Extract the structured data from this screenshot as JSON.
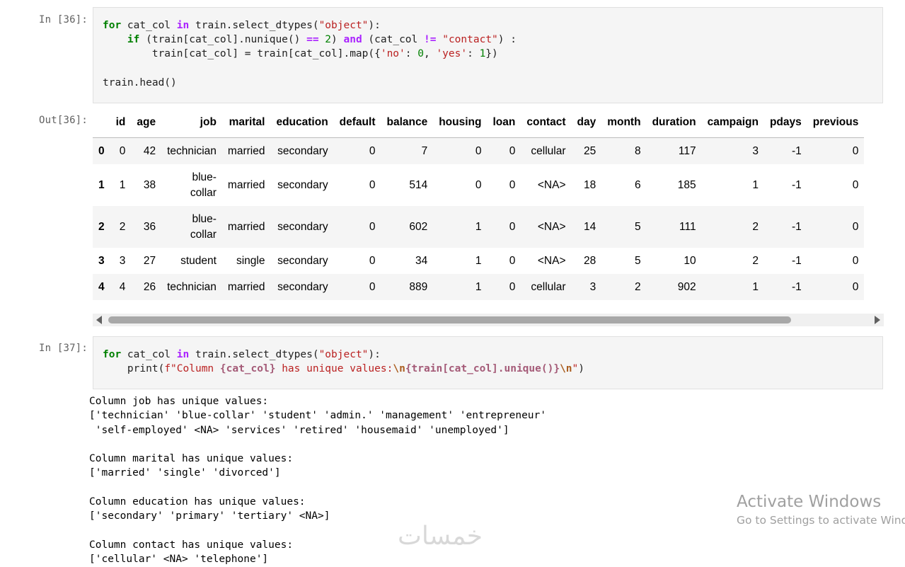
{
  "cell36": {
    "in_prompt": "In [36]:",
    "out_prompt": "Out[36]:",
    "code_line1_kw": "for",
    "code_line1_a": " cat_col ",
    "code_line1_in": "in",
    "code_line1_b": " train.select_dtypes(",
    "code_line1_str": "\"object\"",
    "code_line1_c": "):",
    "code_line2_indent": "    ",
    "code_line2_if": "if",
    "code_line2_a": " (train[cat_col].nunique() ",
    "code_line2_eq": "==",
    "code_line2_sp": " ",
    "code_line2_num": "2",
    "code_line2_b": ") ",
    "code_line2_and": "and",
    "code_line2_c": " (cat_col ",
    "code_line2_ne": "!=",
    "code_line2_sp2": " ",
    "code_line2_str": "\"contact\"",
    "code_line2_d": ") :",
    "code_line3_a": "        train[cat_col] = train[cat_col].map({",
    "code_line3_s1": "'no'",
    "code_line3_b": ": ",
    "code_line3_n1": "0",
    "code_line3_c": ", ",
    "code_line3_s2": "'yes'",
    "code_line3_d": ": ",
    "code_line3_n2": "1",
    "code_line3_e": "})",
    "code_line5": "train.head()"
  },
  "dataframe": {
    "columns": [
      "",
      "id",
      "age",
      "job",
      "marital",
      "education",
      "default",
      "balance",
      "housing",
      "loan",
      "contact",
      "day",
      "month",
      "duration",
      "campaign",
      "pdays",
      "previous"
    ],
    "rows": [
      {
        "index": "0",
        "cells": [
          "0",
          "42",
          "technician",
          "married",
          "secondary",
          "0",
          "7",
          "0",
          "0",
          "cellular",
          "25",
          "8",
          "117",
          "3",
          "-1",
          "0"
        ]
      },
      {
        "index": "1",
        "cells": [
          "1",
          "38",
          "blue-collar",
          "married",
          "secondary",
          "0",
          "514",
          "0",
          "0",
          "<NA>",
          "18",
          "6",
          "185",
          "1",
          "-1",
          "0"
        ]
      },
      {
        "index": "2",
        "cells": [
          "2",
          "36",
          "blue-collar",
          "married",
          "secondary",
          "0",
          "602",
          "1",
          "0",
          "<NA>",
          "14",
          "5",
          "111",
          "2",
          "-1",
          "0"
        ]
      },
      {
        "index": "3",
        "cells": [
          "3",
          "27",
          "student",
          "single",
          "secondary",
          "0",
          "34",
          "1",
          "0",
          "<NA>",
          "28",
          "5",
          "10",
          "2",
          "-1",
          "0"
        ]
      },
      {
        "index": "4",
        "cells": [
          "4",
          "26",
          "technician",
          "married",
          "secondary",
          "0",
          "889",
          "1",
          "0",
          "cellular",
          "3",
          "2",
          "902",
          "1",
          "-1",
          "0"
        ]
      }
    ]
  },
  "cell37": {
    "in_prompt": "In [37]:",
    "line1_kw": "for",
    "line1_a": " cat_col ",
    "line1_in": "in",
    "line1_b": " train.select_dtypes(",
    "line1_str": "\"object\"",
    "line1_c": "):",
    "line2_a": "    print(",
    "line2_str1": "f\"Column ",
    "line2_brace1": "{cat_col}",
    "line2_str2": " has unique values:",
    "line2_esc1": "\\n",
    "line2_brace2": "{train[cat_col].unique()}",
    "line2_esc2": "\\n",
    "line2_str3": "\"",
    "line2_b": ")"
  },
  "output_text": "Column job has unique values:\n['technician' 'blue-collar' 'student' 'admin.' 'management' 'entrepreneur'\n 'self-employed' <NA> 'services' 'retired' 'housemaid' 'unemployed']\n\nColumn marital has unique values:\n['married' 'single' 'divorced']\n\nColumn education has unique values:\n['secondary' 'primary' 'tertiary' <NA>]\n\nColumn contact has unique values:\n['cellular' <NA> 'telephone']",
  "watermark": {
    "logo": "خمسات",
    "activate_title": "Activate Windows",
    "activate_sub": "Go to Settings to activate Windows."
  }
}
